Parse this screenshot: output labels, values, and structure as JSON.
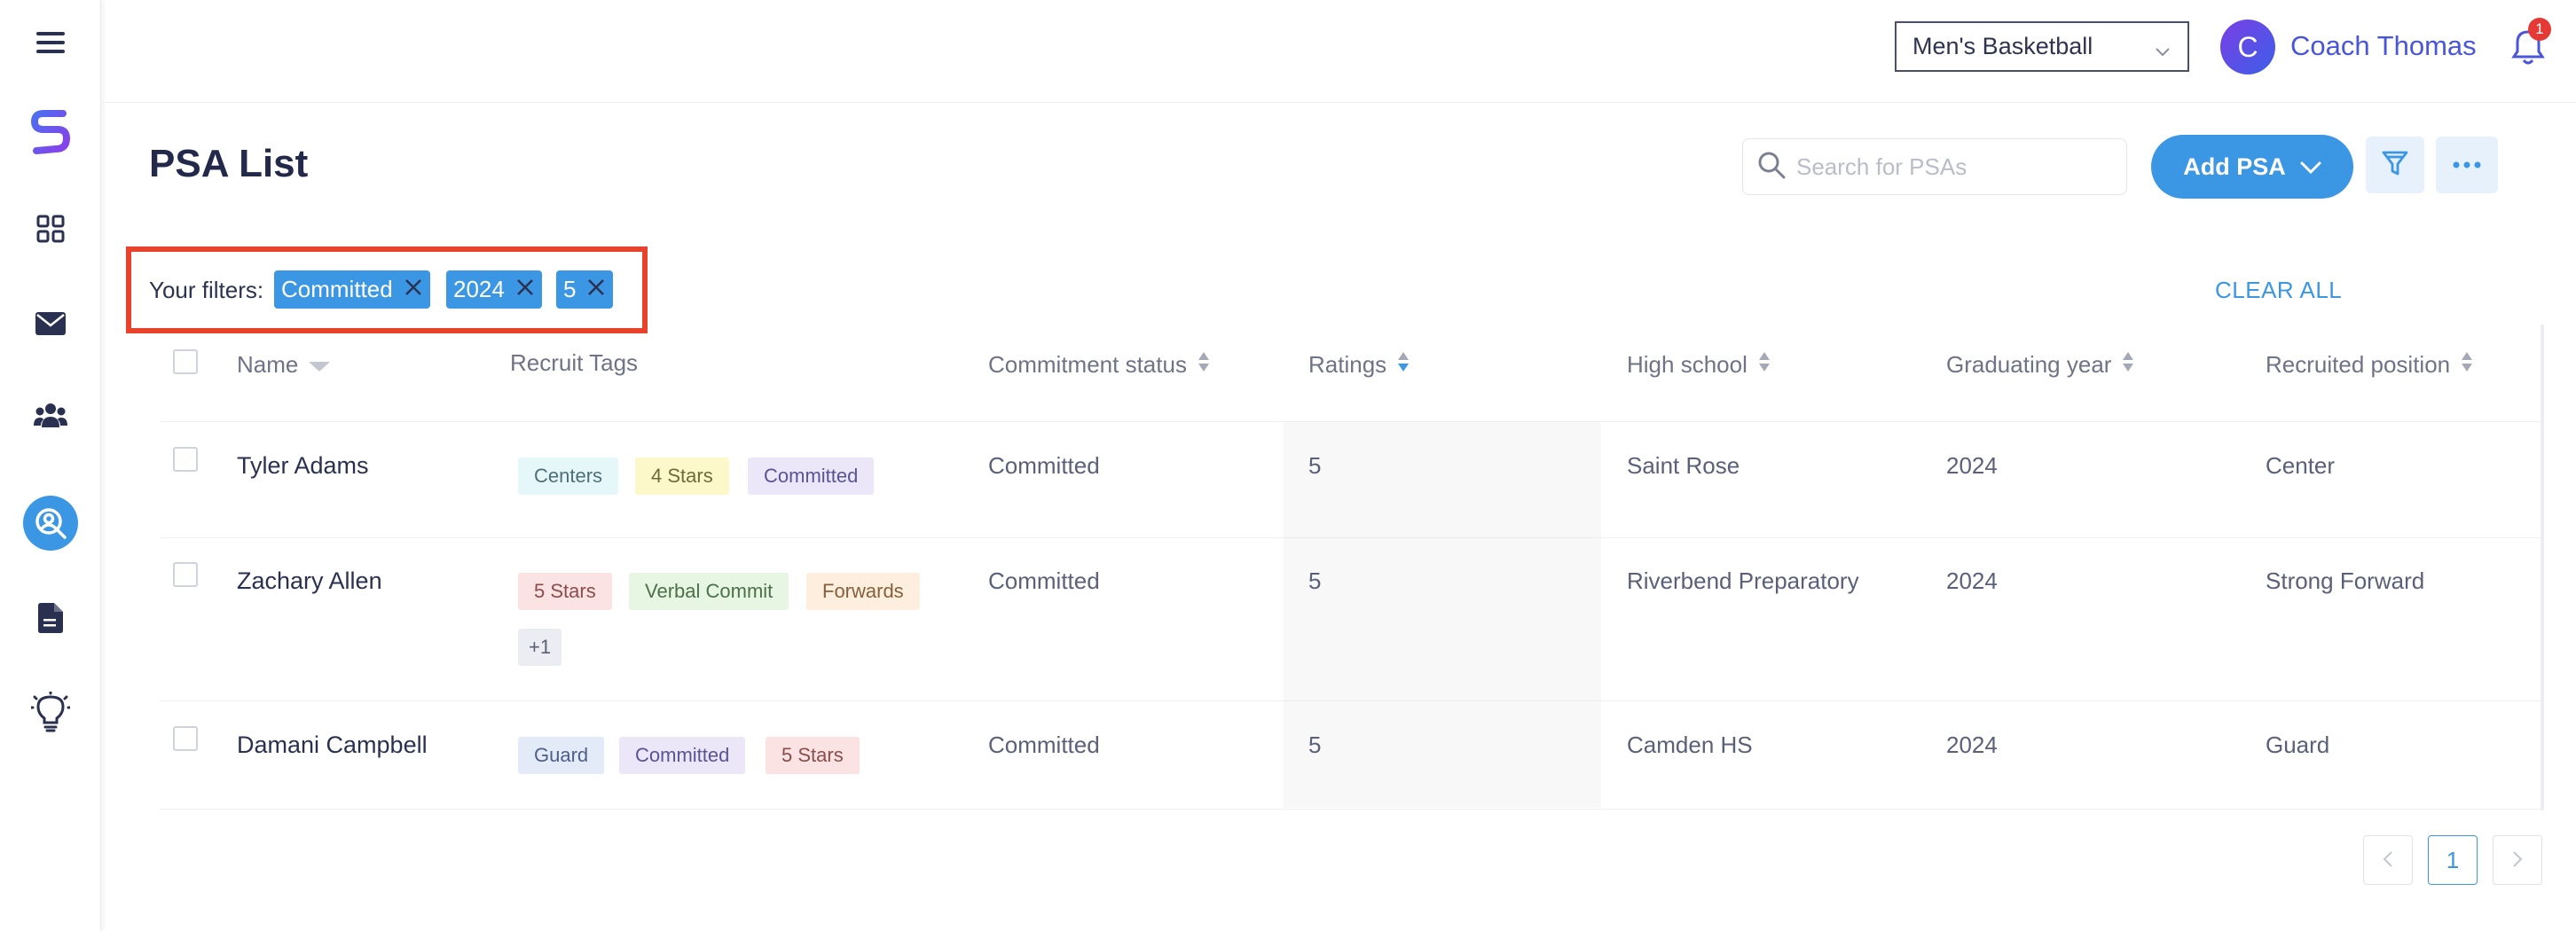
{
  "header": {
    "team_select": "Men's Basketball",
    "avatar_letter": "C",
    "user_name": "Coach Thomas",
    "notification_count": "1"
  },
  "page": {
    "title": "PSA List",
    "search_placeholder": "Search for PSAs",
    "add_button": "Add PSA"
  },
  "filters": {
    "label": "Your filters:",
    "chips": [
      "Committed",
      "2024",
      "5"
    ],
    "clear_all": "CLEAR ALL"
  },
  "table": {
    "columns": [
      "Name",
      "Recruit Tags",
      "Commitment status",
      "Ratings",
      "High school",
      "Graduating year",
      "Recruited position"
    ],
    "rows": [
      {
        "name": "Tyler Adams",
        "tags": [
          "Centers",
          "4 Stars",
          "Committed"
        ],
        "status": "Committed",
        "rating": "5",
        "school": "Saint Rose",
        "year": "2024",
        "position": "Center"
      },
      {
        "name": "Zachary Allen",
        "tags": [
          "5 Stars",
          "Verbal Commit",
          "Forwards",
          "+1"
        ],
        "status": "Committed",
        "rating": "5",
        "school": "Riverbend Preparatory",
        "year": "2024",
        "position": "Strong Forward"
      },
      {
        "name": "Damani Campbell",
        "tags": [
          "Guard",
          "Committed",
          "5 Stars"
        ],
        "status": "Committed",
        "rating": "5",
        "school": "Camden HS",
        "year": "2024",
        "position": "Guard"
      }
    ]
  },
  "pagination": {
    "current_page": "1"
  },
  "icons": {
    "sidebar": [
      "menu-icon",
      "logo-icon",
      "dashboard-icon",
      "mail-icon",
      "team-icon",
      "recruit-search-icon",
      "document-icon",
      "idea-icon"
    ]
  },
  "colors": {
    "accent": "#3b97e3",
    "highlight_box": "#e8412c"
  }
}
